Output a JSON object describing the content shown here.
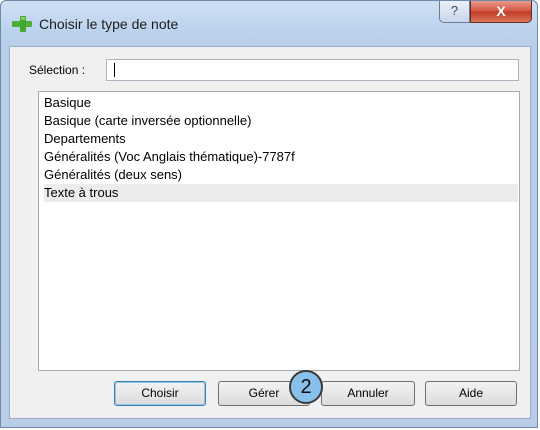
{
  "window": {
    "title": "Choisir le type de note",
    "help_label": "?",
    "close_label": "X"
  },
  "selection": {
    "label": "Sélection :",
    "value": ""
  },
  "note_types": [
    {
      "label": "Basique",
      "selected": false
    },
    {
      "label": "Basique (carte inversée optionnelle)",
      "selected": false
    },
    {
      "label": "Departements",
      "selected": false
    },
    {
      "label": "Généralités (Voc Anglais thématique)-7787f",
      "selected": false
    },
    {
      "label": "Généralités (deux sens)",
      "selected": false
    },
    {
      "label": "Texte à trous",
      "selected": true
    }
  ],
  "buttons": {
    "choose": "Choisir",
    "manage": "Gérer",
    "cancel": "Annuler",
    "help": "Aide"
  },
  "annotation": {
    "step_number": "2"
  }
}
